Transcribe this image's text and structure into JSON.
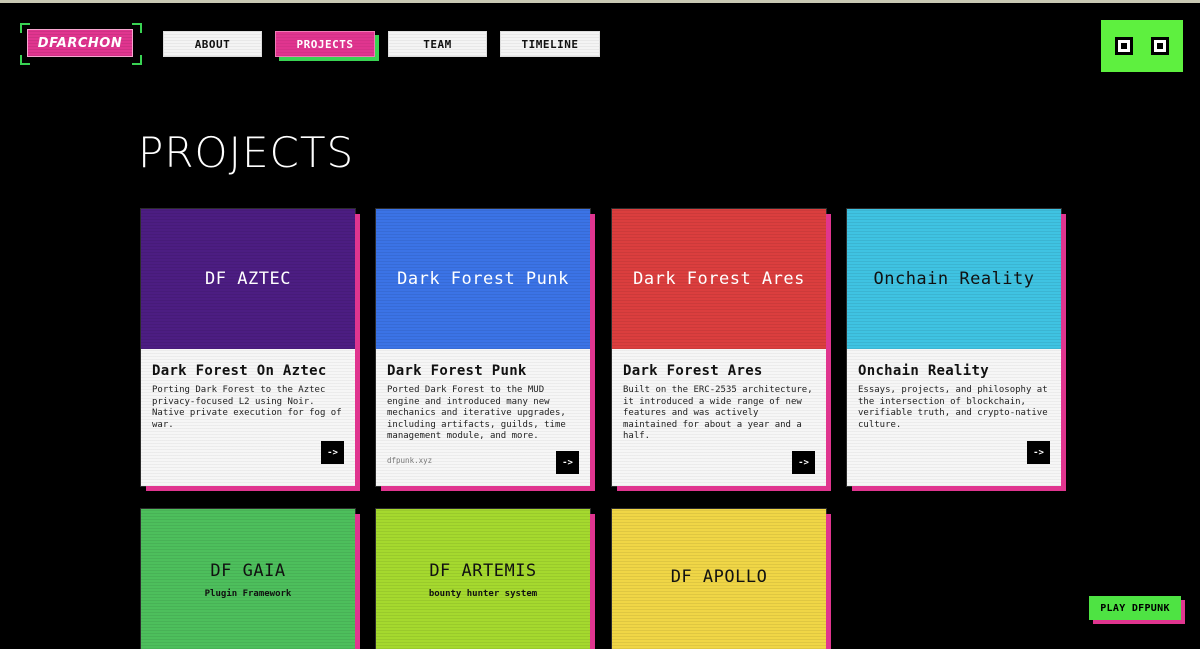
{
  "logo": {
    "text": "DFARCHON"
  },
  "nav": {
    "about": "ABOUT",
    "projects": "PROJECTS",
    "team": "TEAM",
    "timeline": "TIMELINE"
  },
  "page": {
    "title": "PROJECTS"
  },
  "cards": [
    {
      "top_title": "DF AZTEC",
      "title": "Dark Forest On Aztec",
      "description": "Porting Dark Forest to the Aztec privacy-focused L2 using Noir. Native private execution for fog of war.",
      "arrow": "->",
      "color": "#4c1d82"
    },
    {
      "top_title": "Dark Forest Punk",
      "title": "Dark Forest Punk",
      "description": "Ported Dark Forest to the MUD engine and introduced many new mechanics and iterative upgrades, including artifacts, guilds, time management module, and more.",
      "link": "dfpunk.xyz",
      "arrow": "->",
      "color": "#3b73e6"
    },
    {
      "top_title": "Dark Forest Ares",
      "title": "Dark Forest Ares",
      "description": "Built on the ERC-2535 architecture, it introduced a wide range of new features and was actively maintained for about a year and a half.",
      "arrow": "->",
      "color": "#db3e3e"
    },
    {
      "top_title": "Onchain Reality",
      "title": "Onchain Reality",
      "description": "Essays, projects, and philosophy at the intersection of blockchain, verifiable truth, and crypto-native culture.",
      "arrow": "->",
      "color": "#3fc3e2"
    },
    {
      "top_title": "DF GAIA",
      "subtitle": "Plugin Framework",
      "color": "#4dbf5c"
    },
    {
      "top_title": "DF ARTEMIS",
      "subtitle": "bounty hunter system",
      "color": "#a5d92e"
    },
    {
      "top_title": "DF APOLLO",
      "color": "#f0d646"
    }
  ],
  "play_button": "PLAY DFPUNK",
  "colors": {
    "accent_pink": "#e0358f",
    "accent_green": "#5ef03f",
    "background": "#000000"
  },
  "icons": {
    "theme_toggle": "window-toggle-icon",
    "arrow": "arrow-right-icon"
  }
}
